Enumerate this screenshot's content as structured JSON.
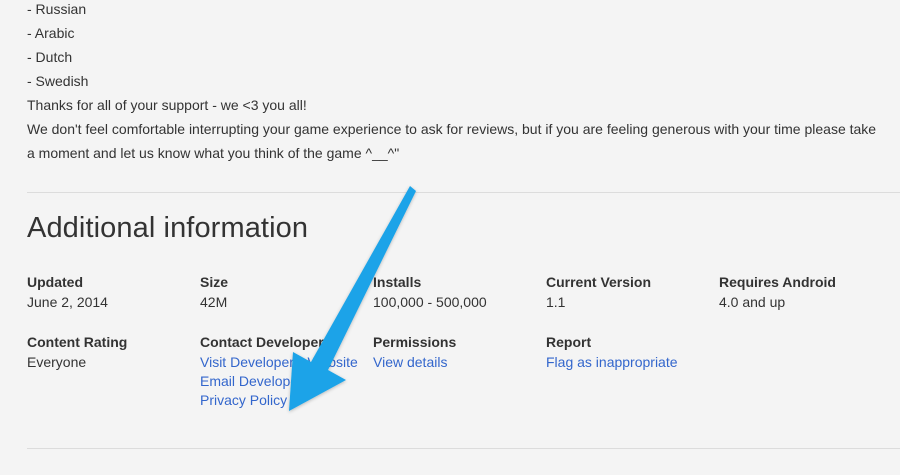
{
  "changelog": {
    "languages": [
      "- Russian",
      "- Arabic",
      "- Dutch",
      "- Swedish"
    ],
    "thanks": "Thanks for all of your support - we <3 you all!",
    "review_request": "We don't feel comfortable interrupting your game experience to ask for reviews, but if you are feeling generous with your time please take a moment and let us know what you think of the game ^__^\""
  },
  "additional_info": {
    "title": "Additional information",
    "updated": {
      "label": "Updated",
      "value": "June 2, 2014"
    },
    "size": {
      "label": "Size",
      "value": "42M"
    },
    "installs": {
      "label": "Installs",
      "value": "100,000 - 500,000"
    },
    "current_version": {
      "label": "Current Version",
      "value": "1.1"
    },
    "requires_android": {
      "label": "Requires Android",
      "value": "4.0 and up"
    },
    "content_rating": {
      "label": "Content Rating",
      "value": "Everyone"
    },
    "contact_developer": {
      "label": "Contact Developer",
      "links": [
        "Visit Developer's Website",
        "Email Developer",
        "Privacy Policy"
      ]
    },
    "permissions": {
      "label": "Permissions",
      "link": "View details"
    },
    "report": {
      "label": "Report",
      "link": "Flag as inappropriate"
    }
  },
  "annotation": {
    "arrow_color": "#1aa3e8",
    "arrow_icon": "arrow-pointing-down-left"
  },
  "colors": {
    "background": "#f4f4f4",
    "text": "#333333",
    "link": "#3366cc",
    "divider": "#dcdcdc"
  }
}
